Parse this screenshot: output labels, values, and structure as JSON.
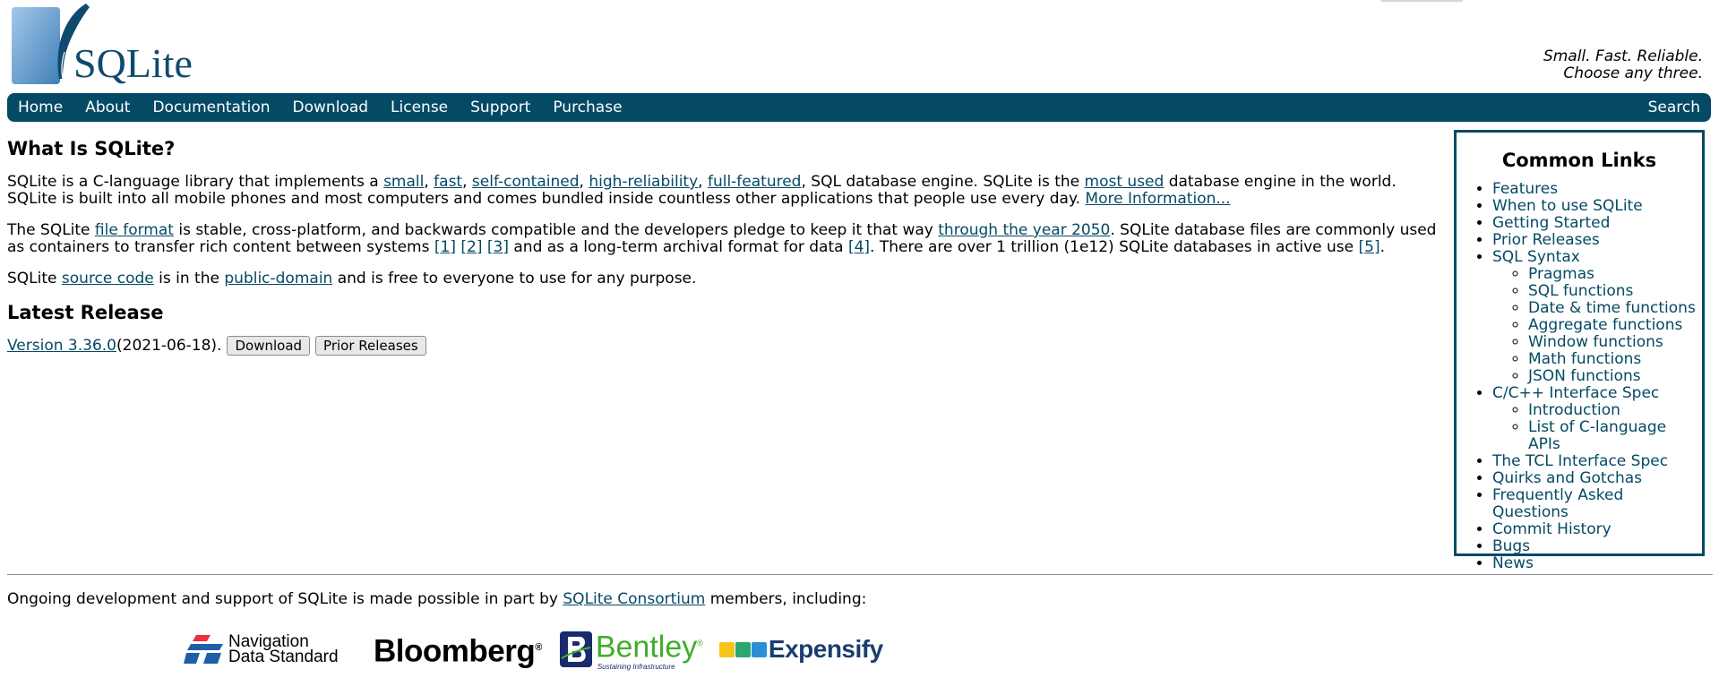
{
  "header": {
    "logo_text": "SQLite",
    "tagline_1": "Small. Fast. Reliable.",
    "tagline_2": "Choose any three."
  },
  "nav": {
    "items": [
      "Home",
      "About",
      "Documentation",
      "Download",
      "License",
      "Support",
      "Purchase"
    ],
    "search": "Search",
    "colors": {
      "bar": "#044a64",
      "text": "#ffffff"
    }
  },
  "main": {
    "title": "What Is SQLite?",
    "p1": {
      "t1": "SQLite is a C-language library that implements a ",
      "l1": "small",
      "t2": ", ",
      "l2": "fast",
      "t3": ", ",
      "l3": "self-contained",
      "t4": ", ",
      "l4": "high-reliability",
      "t5": ", ",
      "l5": "full-featured",
      "t6": ", SQL database engine. SQLite is the ",
      "l6": "most used",
      "t7": " database engine in the world. SQLite is built into all mobile phones and most computers and comes bundled inside countless other applications that people use every day. ",
      "l7": "More Information..."
    },
    "p2": {
      "t1": "The SQLite ",
      "l1": "file format",
      "t2": " is stable, cross-platform, and backwards compatible and the developers pledge to keep it that way ",
      "l2": "through the year 2050",
      "t3": ". SQLite database files are commonly used as containers to transfer rich content between systems ",
      "l3": "[1]",
      "l4": "[2]",
      "l5": "[3]",
      "t4": " and as a long-term archival format for data ",
      "l6": "[4]",
      "t5": ". There are over 1 trillion (1e12) SQLite databases in active use ",
      "l7": "[5]",
      "t6": "."
    },
    "p3": {
      "t1": "SQLite ",
      "l1": "source code",
      "t2": " is in the ",
      "l2": "public-domain",
      "t3": " and is free to everyone to use for any purpose."
    },
    "latest_title": "Latest Release",
    "release": {
      "version_link": "Version 3.36.0",
      "date": " (2021-06-18).",
      "download_button": "Download",
      "prior_button": "Prior Releases"
    }
  },
  "sidebar": {
    "title": "Common Links",
    "items": [
      {
        "label": "Features"
      },
      {
        "label": "When to use SQLite"
      },
      {
        "label": "Getting Started"
      },
      {
        "label": "Prior Releases"
      },
      {
        "label": "SQL Syntax",
        "children": [
          "Pragmas",
          "SQL functions",
          "Date & time functions",
          "Aggregate functions",
          "Window functions",
          "Math functions",
          "JSON functions"
        ]
      },
      {
        "label": "C/C++ Interface Spec",
        "children": [
          "Introduction",
          "List of C-language APIs"
        ]
      },
      {
        "label": "The TCL Interface Spec"
      },
      {
        "label": "Quirks and Gotchas"
      },
      {
        "label": "Frequently Asked Questions"
      },
      {
        "label": "Commit History"
      },
      {
        "label": "Bugs"
      },
      {
        "label": "News"
      }
    ]
  },
  "footer": {
    "t1": "Ongoing development and support of SQLite is made possible in part by ",
    "link": "SQLite Consortium",
    "t2": " members, including:",
    "sponsors": {
      "nds_line1": "Navigation",
      "nds_line2": "Data Standard",
      "bloomberg": "Bloomberg",
      "bloomberg_mark": "®",
      "bentley": "Bentley",
      "bentley_mark": "®",
      "bentley_tag": "Sustaining Infrastructure",
      "expensify": "Expensify"
    }
  }
}
